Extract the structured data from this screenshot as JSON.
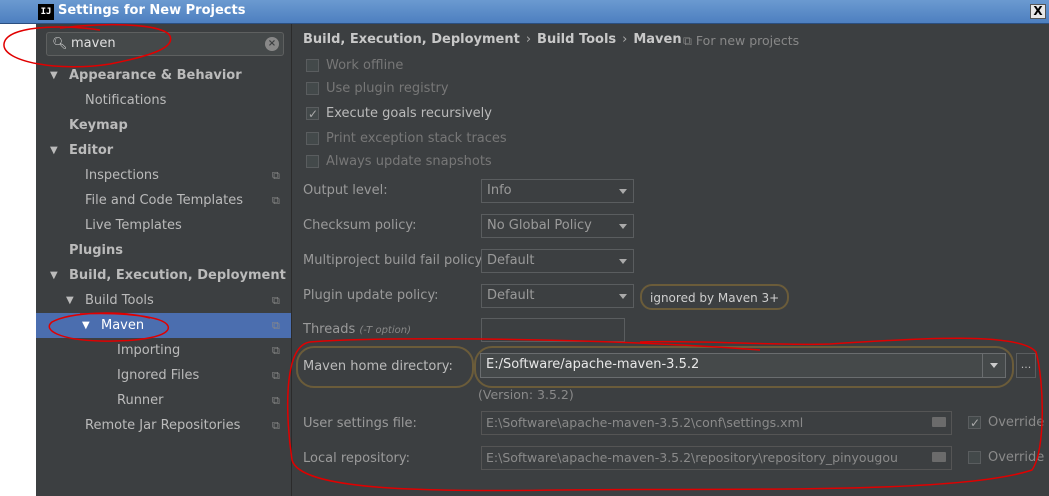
{
  "window": {
    "title": "Settings for New Projects",
    "app_icon_text": "IJ",
    "close_glyph": "X"
  },
  "search": {
    "value": "maven",
    "icon": "search-icon"
  },
  "sidebar": {
    "items": [
      {
        "label": "Appearance & Behavior",
        "bold": true,
        "arrow": "▼",
        "copy": false
      },
      {
        "label": "Notifications",
        "bold": false,
        "arrow": "",
        "copy": false
      },
      {
        "label": "Keymap",
        "bold": true,
        "arrow": "",
        "copy": false
      },
      {
        "label": "Editor",
        "bold": true,
        "arrow": "▼",
        "copy": false
      },
      {
        "label": "Inspections",
        "bold": false,
        "arrow": "",
        "copy": true
      },
      {
        "label": "File and Code Templates",
        "bold": false,
        "arrow": "",
        "copy": true
      },
      {
        "label": "Live Templates",
        "bold": false,
        "arrow": "",
        "copy": false
      },
      {
        "label": "Plugins",
        "bold": true,
        "arrow": "",
        "copy": false
      },
      {
        "label": "Build, Execution, Deployment",
        "bold": true,
        "arrow": "▼",
        "copy": false
      },
      {
        "label": "Build Tools",
        "bold": false,
        "arrow": "▼",
        "copy": true
      },
      {
        "label": "Maven",
        "bold": false,
        "arrow": "▼",
        "copy": true,
        "selected": true
      },
      {
        "label": "Importing",
        "bold": false,
        "arrow": "",
        "copy": true
      },
      {
        "label": "Ignored Files",
        "bold": false,
        "arrow": "",
        "copy": true
      },
      {
        "label": "Runner",
        "bold": false,
        "arrow": "",
        "copy": true
      },
      {
        "label": "Remote Jar Repositories",
        "bold": false,
        "arrow": "",
        "copy": true
      }
    ]
  },
  "breadcrumb": {
    "part1": "Build, Execution, Deployment",
    "part2": "Build Tools",
    "part3": "Maven",
    "separator": "›",
    "note": "For new projects",
    "note_icon": "⧉"
  },
  "checkboxes": [
    {
      "label": "Work offline",
      "checked": false
    },
    {
      "label": "Use plugin registry",
      "checked": false
    },
    {
      "label": "Execute goals recursively",
      "checked": true
    },
    {
      "label": "Print exception stack traces",
      "checked": false
    },
    {
      "label": "Always update snapshots",
      "checked": false
    }
  ],
  "fields": {
    "output_level": {
      "label": "Output level:",
      "value": "Info"
    },
    "checksum_policy": {
      "label": "Checksum policy:",
      "value": "No Global Policy"
    },
    "multiproject_fail": {
      "label": "Multiproject build fail policy:",
      "value": "Default"
    },
    "plugin_update": {
      "label": "Plugin update policy:",
      "value": "Default",
      "note": "ignored by Maven 3+"
    },
    "threads": {
      "label": "Threads",
      "hint": "(-T option)",
      "value": ""
    },
    "maven_home": {
      "label": "Maven home directory:",
      "value": "E:/Software/apache-maven-3.5.2",
      "browse": "...",
      "version": "(Version: 3.5.2)"
    },
    "user_settings": {
      "label": "User settings file:",
      "value": "E:\\Software\\apache-maven-3.5.2\\conf\\settings.xml",
      "override_label": "Override",
      "override_checked": true
    },
    "local_repo": {
      "label": "Local repository:",
      "value": "E:\\Software\\apache-maven-3.5.2\\repository\\repository_pinyougou",
      "override_label": "Override",
      "override_checked": false
    }
  },
  "colors": {
    "selection": "#4b6eaf",
    "background": "#3c3f41",
    "annotation_red": "#e00000",
    "annotation_gold": "#6b5c3a"
  }
}
